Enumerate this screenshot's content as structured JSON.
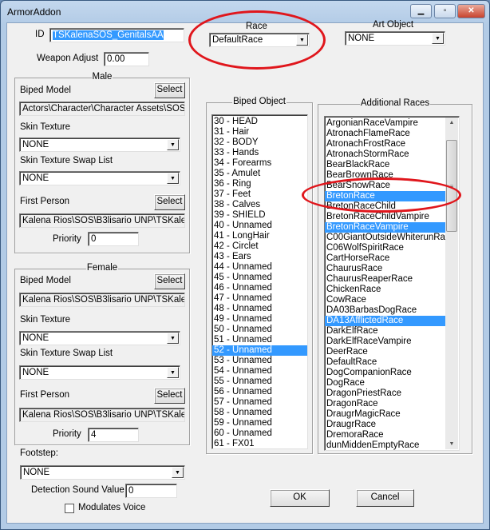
{
  "window": {
    "title": "ArmorAddon",
    "controls": [
      "minimize",
      "maximize",
      "close"
    ]
  },
  "id": {
    "label": "ID",
    "value": "TSKalenaSOS_GenitalsAA"
  },
  "weapon_adjust": {
    "label": "Weapon Adjust",
    "value": "0.00"
  },
  "race": {
    "label": "Race",
    "value": "DefaultRace"
  },
  "art_object": {
    "label": "Art Object",
    "value": "NONE"
  },
  "male": {
    "title": "Male",
    "biped_model_label": "Biped Model",
    "biped_model_path": "Actors\\Character\\Character Assets\\SOS\\S",
    "select_label": "Select",
    "skin_texture_label": "Skin Texture",
    "skin_texture": "NONE",
    "swap_list_label": "Skin Texture Swap List",
    "swap_list": "NONE",
    "first_person_label": "First Person",
    "first_person_path": "Kalena Rios\\SOS\\B3lisario UNP\\TSKalena",
    "priority_label": "Priority",
    "priority": "0"
  },
  "female": {
    "title": "Female",
    "biped_model_label": "Biped Model",
    "biped_model_path": "Kalena Rios\\SOS\\B3lisario UNP\\TSKalena",
    "select_label": "Select",
    "skin_texture_label": "Skin Texture",
    "skin_texture": "NONE",
    "swap_list_label": "Skin Texture Swap List",
    "swap_list": "NONE",
    "first_person_label": "First Person",
    "first_person_path": "Kalena Rios\\SOS\\B3lisario UNP\\TSKalena",
    "priority_label": "Priority",
    "priority": "4"
  },
  "footstep": {
    "label": "Footstep:",
    "value": "NONE"
  },
  "detection": {
    "label": "Detection Sound Value",
    "value": "0"
  },
  "modulates_voice": {
    "label": "Modulates Voice",
    "checked": false
  },
  "biped_object": {
    "title": "Biped Object",
    "items": [
      "30 - HEAD",
      "31 - Hair",
      "32 - BODY",
      "33 - Hands",
      "34 - Forearms",
      "35 - Amulet",
      "36 - Ring",
      "37 - Feet",
      "38 - Calves",
      "39 - SHIELD",
      "40 - Unnamed",
      "41 - LongHair",
      "42 - Circlet",
      "43 - Ears",
      "44 - Unnamed",
      "45 - Unnamed",
      "46 - Unnamed",
      "47 - Unnamed",
      "48 - Unnamed",
      "49 - Unnamed",
      "50 - Unnamed",
      "51 - Unnamed",
      "52 - Unnamed",
      "53 - Unnamed",
      "54 - Unnamed",
      "55 - Unnamed",
      "56 - Unnamed",
      "57 - Unnamed",
      "58 - Unnamed",
      "59 - Unnamed",
      "60 - Unnamed",
      "61 - FX01"
    ],
    "selected": [
      "52 - Unnamed"
    ]
  },
  "additional_races": {
    "title": "Additional Races",
    "items": [
      "ArgonianRaceVampire",
      "AtronachFlameRace",
      "AtronachFrostRace",
      "AtronachStormRace",
      "BearBlackRace",
      "BearBrownRace",
      "BearSnowRace",
      "BretonRace",
      "BretonRaceChild",
      "BretonRaceChildVampire",
      "BretonRaceVampire",
      "C00GiantOutsideWhiterunRace",
      "C06WolfSpiritRace",
      "CartHorseRace",
      "ChaurusRace",
      "ChaurusReaperRace",
      "ChickenRace",
      "CowRace",
      "DA03BarbasDogRace",
      "DA13AfflictedRace",
      "DarkElfRace",
      "DarkElfRaceVampire",
      "DeerRace",
      "DefaultRace",
      "DogCompanionRace",
      "DogRace",
      "DragonPriestRace",
      "DragonRace",
      "DraugrMagicRace",
      "DraugrRace",
      "DremoraRace",
      "dunMiddenEmptyRace"
    ],
    "selected": [
      "BretonRace",
      "BretonRaceVampire",
      "DA13AfflictedRace"
    ]
  },
  "buttons": {
    "ok": "OK",
    "cancel": "Cancel"
  },
  "annotation_color": "#e0161c",
  "selection_color": "#3399ff"
}
